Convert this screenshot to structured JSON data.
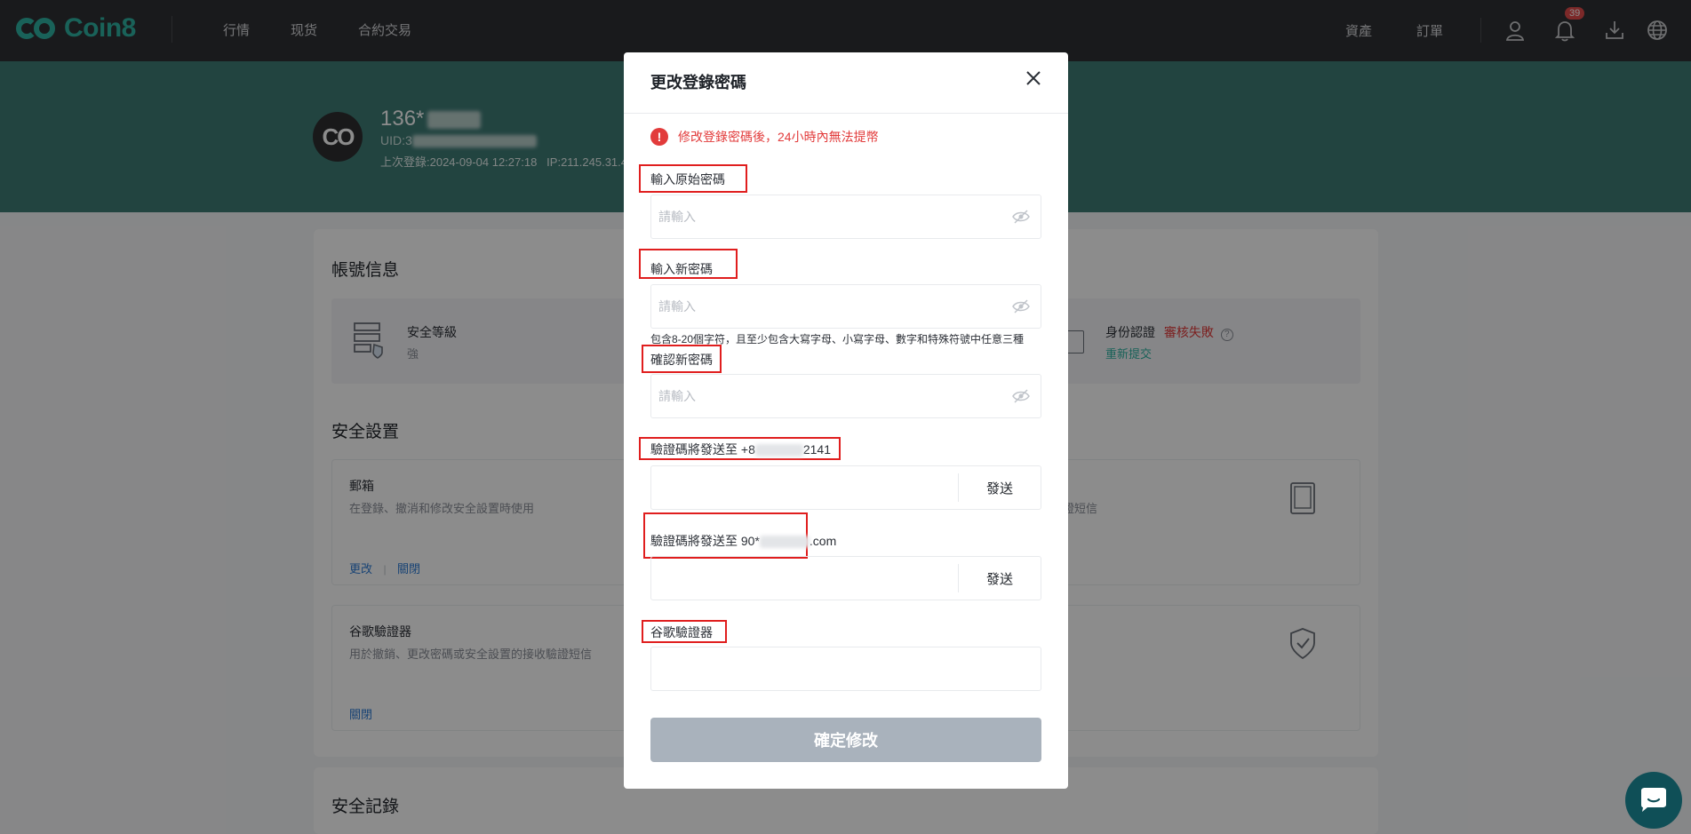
{
  "header": {
    "logo_text": "Coin8",
    "nav": [
      "行情",
      "现货",
      "合約交易"
    ],
    "assets": "資產",
    "orders": "訂單",
    "notification_count": "39"
  },
  "profile": {
    "username": "136*",
    "uid": "UID:3",
    "last_login": "上次登錄:2024-09-04 12:27:18",
    "ip": "IP:211.245.31.41"
  },
  "account": {
    "section_title": "帳號信息",
    "security_level_label": "安全等級",
    "security_level_value": "強",
    "identity_label": "身份認證",
    "identity_status": "審核失敗",
    "identity_action": "重新提交"
  },
  "security": {
    "section_title": "安全設置",
    "email_title": "郵箱",
    "email_desc": "在登錄、撤消和修改安全設置時使用",
    "email_change": "更改",
    "email_close": "關閉",
    "right_desc": "證短信",
    "google_title": "谷歌驗證器",
    "google_desc": "用於撤銷、更改密碼或安全設置的接收驗證短信",
    "google_close": "關閉"
  },
  "records": {
    "section_title": "安全記錄"
  },
  "modal": {
    "title": "更改登錄密碼",
    "warning": "修改登錄密碼後，24小時內無法提幣",
    "original_label": "輸入原始密碼",
    "new_label": "輸入新密碼",
    "confirm_label": "確認新密碼",
    "placeholder": "請輸入",
    "password_hint": "包含8-20個字符，且至少包含大寫字母、小寫字母、數字和特殊符號中任意三種",
    "sms_label_prefix": "驗證碼將發送至 +8",
    "sms_label_suffix": "2141",
    "email_label_prefix": "驗證碼將發送至 90*",
    "email_label_suffix": ".com",
    "send": "發送",
    "google_label": "谷歌驗證器",
    "submit": "確定修改"
  }
}
